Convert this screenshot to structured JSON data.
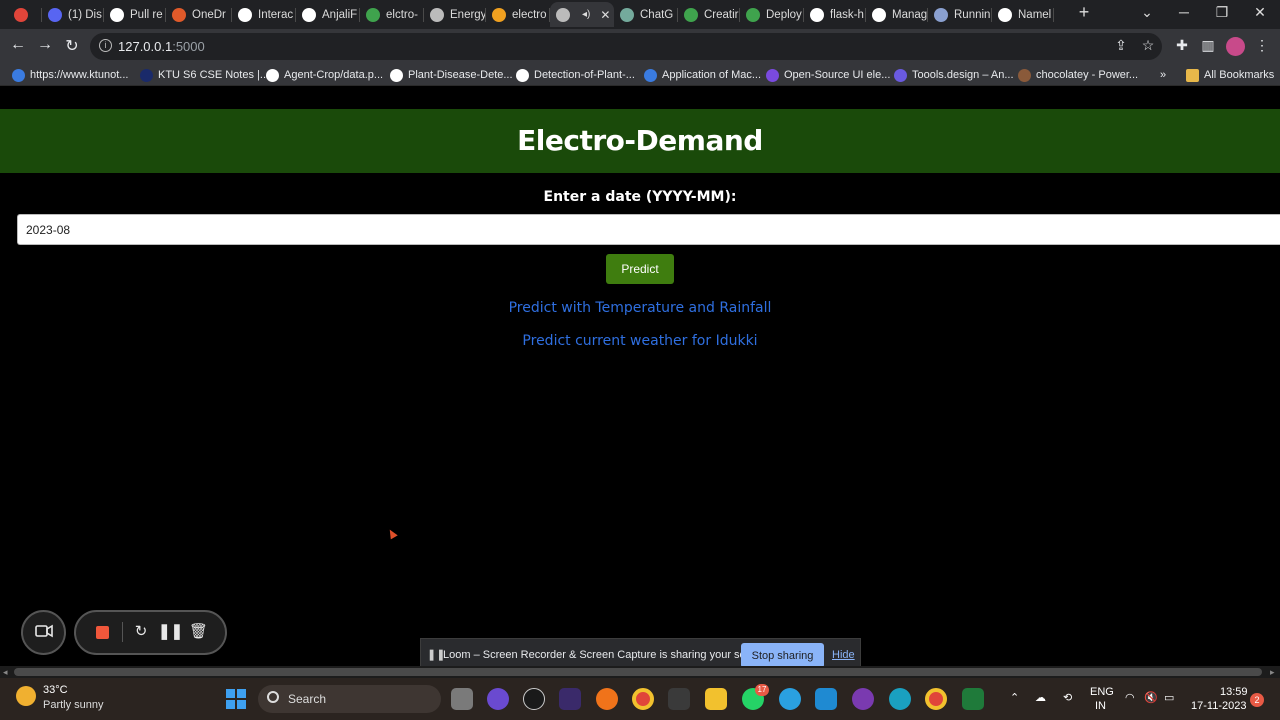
{
  "browser": {
    "tabs": [
      {
        "label": "",
        "icon": "record-icon",
        "color": "#e0453a"
      },
      {
        "label": "(1) Dis",
        "icon": "discord-icon",
        "color": "#5865f2"
      },
      {
        "label": "Pull re",
        "icon": "github-icon",
        "color": "#ffffff"
      },
      {
        "label": "OneDr",
        "icon": "onedrive-icon",
        "color": "#e05a2a"
      },
      {
        "label": "Interac",
        "icon": "page-icon",
        "color": "#ffffff"
      },
      {
        "label": "AnjaliF",
        "icon": "github-icon",
        "color": "#ffffff"
      },
      {
        "label": "elctro-",
        "icon": "deploy-icon",
        "color": "#3fa34d"
      },
      {
        "label": "Energy",
        "icon": "globe-icon",
        "color": "#bbbbbb"
      },
      {
        "label": "electro",
        "icon": "notebook-icon",
        "color": "#f0a020"
      },
      {
        "label": "",
        "icon": "globe-icon",
        "color": "#bbbbbb",
        "active": true
      },
      {
        "label": "ChatG",
        "icon": "chatgpt-icon",
        "color": "#74aa9c"
      },
      {
        "label": "Creatir",
        "icon": "link-icon",
        "color": "#3fa34d"
      },
      {
        "label": "Deploy",
        "icon": "deploy-icon",
        "color": "#3fa34d"
      },
      {
        "label": "flask-h",
        "icon": "github-icon",
        "color": "#ffffff"
      },
      {
        "label": "Manag",
        "icon": "github-icon",
        "color": "#ffffff"
      },
      {
        "label": "Runnin",
        "icon": "doc-icon",
        "color": "#8aa0d0"
      },
      {
        "label": "Namel",
        "icon": "google-icon",
        "color": "#ffffff"
      }
    ],
    "url_host": "127.0.0.1",
    "url_port": ":5000",
    "bookmarks": [
      {
        "label": "https://www.ktunot...",
        "color": "#3a7be0"
      },
      {
        "label": "KTU S6 CSE Notes |...",
        "color": "#1a2a6a"
      },
      {
        "label": "Agent-Crop/data.p...",
        "color": "#ffffff"
      },
      {
        "label": "Plant-Disease-Dete...",
        "color": "#ffffff"
      },
      {
        "label": "Detection-of-Plant-...",
        "color": "#ffffff"
      },
      {
        "label": "Application of Mac...",
        "color": "#3a7be0"
      },
      {
        "label": "Open-Source UI ele...",
        "color": "#7a4ae0"
      },
      {
        "label": "Toools.design – An...",
        "color": "#6a5ae0"
      },
      {
        "label": "chocolatey - Power...",
        "color": "#8a5a3a"
      }
    ],
    "bookmarks_more": "»",
    "all_bookmarks": "All Bookmarks"
  },
  "page": {
    "title": "Electro-Demand",
    "date_label": "Enter a date (YYYY-MM):",
    "date_value": "2023-08",
    "predict_button": "Predict",
    "link_temp_rain": "Predict with Temperature and Rainfall",
    "link_weather": "Predict current weather for Idukki"
  },
  "sharing": {
    "message": "Loom – Screen Recorder & Screen Capture is sharing your screen.",
    "stop": "Stop sharing",
    "hide": "Hide"
  },
  "taskbar": {
    "temp": "33°C",
    "weather": "Partly sunny",
    "search": "Search",
    "lang_top": "ENG",
    "lang_bottom": "IN",
    "time": "13:59",
    "date": "17-11-2023",
    "notif_count": "2",
    "whatsapp_badge": "17"
  }
}
